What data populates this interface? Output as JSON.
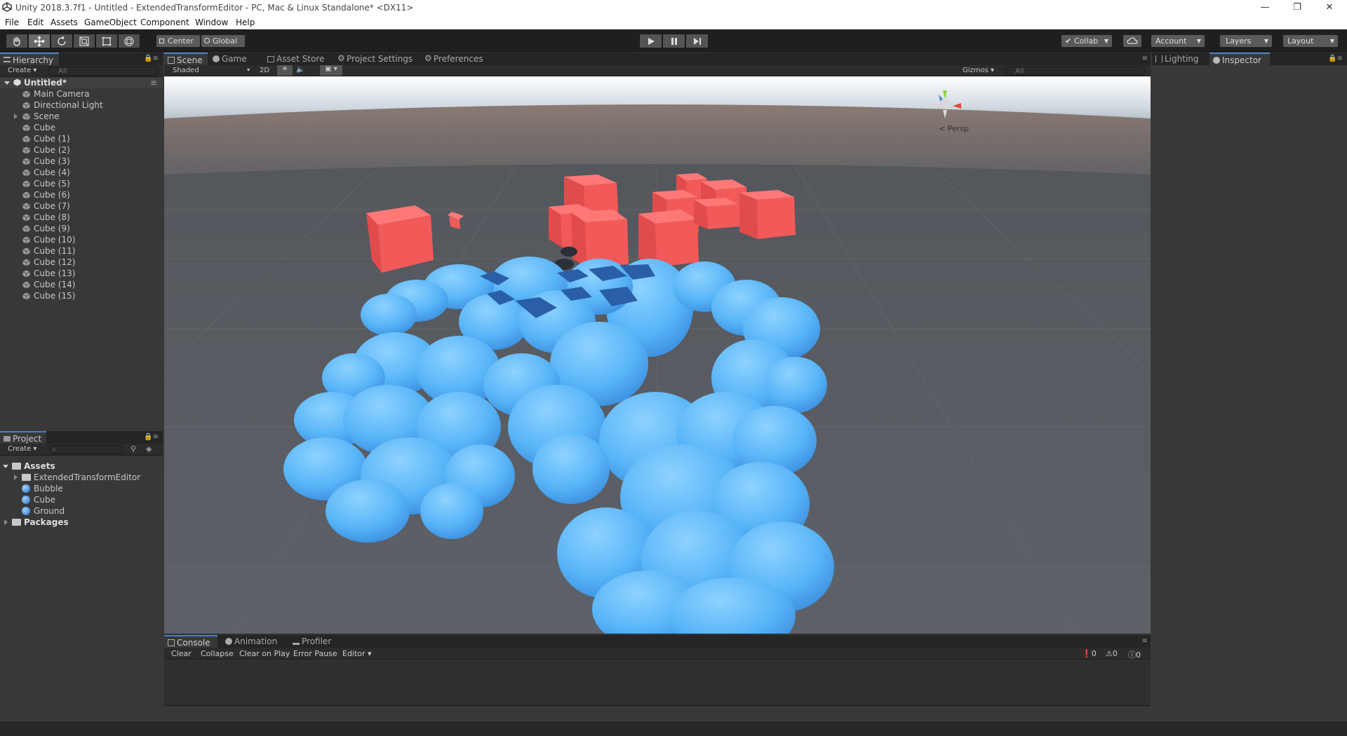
{
  "titlebar": {
    "title": "Unity 2018.3.7f1 - Untitled - ExtendedTransformEditor - PC, Mac & Linux Standalone* <DX11>"
  },
  "menu": {
    "items": [
      "File",
      "Edit",
      "Assets",
      "GameObject",
      "Component",
      "Window",
      "Help"
    ]
  },
  "toolbar": {
    "center": "Center",
    "global": "Global",
    "collab": "Collab",
    "account": "Account",
    "layers": "Layers",
    "layout": "Layout"
  },
  "hierarchy": {
    "tab": "Hierarchy",
    "create": "Create",
    "search_placeholder": "All",
    "scene": "Untitled*",
    "items": [
      "Main Camera",
      "Directional Light",
      "Scene",
      "Cube",
      "Cube (1)",
      "Cube (2)",
      "Cube (3)",
      "Cube (4)",
      "Cube (5)",
      "Cube (6)",
      "Cube (7)",
      "Cube (8)",
      "Cube (9)",
      "Cube (10)",
      "Cube (11)",
      "Cube (12)",
      "Cube (13)",
      "Cube (14)",
      "Cube (15)"
    ]
  },
  "project": {
    "tab": "Project",
    "create": "Create",
    "assets": "Assets",
    "items": [
      "ExtendedTransformEditor",
      "Bubble",
      "Cube",
      "Ground"
    ],
    "packages": "Packages"
  },
  "sceneview": {
    "tabs": [
      "Scene",
      "Game",
      "Asset Store",
      "Project Settings",
      "Preferences"
    ],
    "shading": "Shaded",
    "mode2d": "2D",
    "gizmos": "Gizmos",
    "search_placeholder": "All",
    "persp": "Persp"
  },
  "inspector": {
    "tabs": [
      "Lighting",
      "Inspector"
    ]
  },
  "console": {
    "tabs": [
      "Console",
      "Animation",
      "Profiler"
    ],
    "buttons": [
      "Clear",
      "Collapse",
      "Clear on Play",
      "Error Pause",
      "Editor"
    ],
    "errors": "0",
    "warnings": "0",
    "logs": "0"
  },
  "colors": {
    "accent": "#4a80c0",
    "cube_red": "#f25a5a",
    "bubble_blue": "#58b6f8",
    "bubble_dark": "#2a5fa8"
  }
}
